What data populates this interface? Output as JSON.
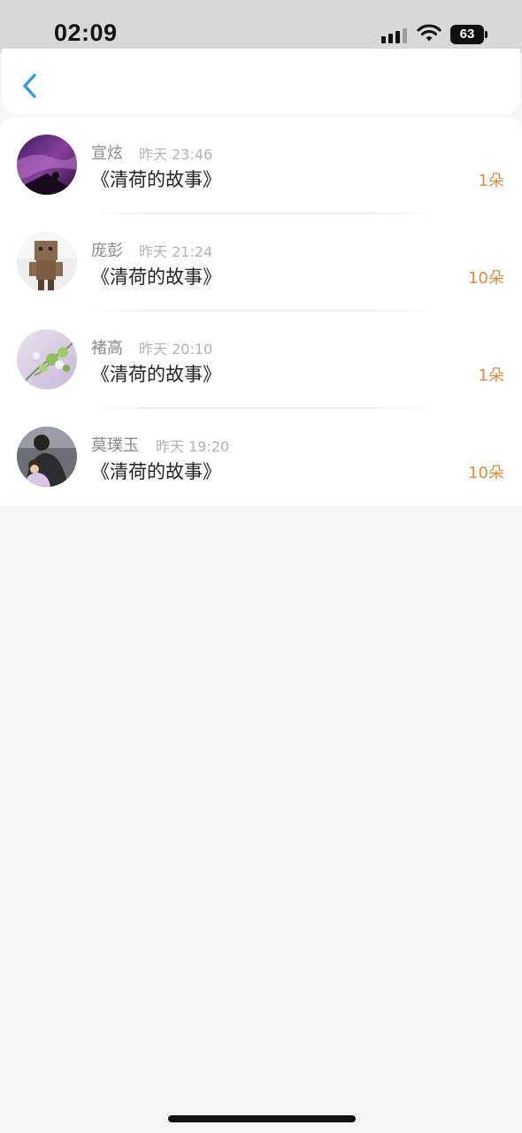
{
  "status_bar": {
    "time": "02:09",
    "battery": "63",
    "icons": [
      "signal-icon",
      "wifi-icon",
      "battery-icon"
    ]
  },
  "header": {
    "back_icon": "chevron-left-icon",
    "accent_color": "#2e9fdc"
  },
  "records": [
    {
      "name": "宣炫",
      "time": "昨天 23:46",
      "title": "《清荷的故事》",
      "count": "1朵"
    },
    {
      "name": "庞彭",
      "time": "昨天 21:24",
      "title": "《清荷的故事》",
      "count": "10朵"
    },
    {
      "name": "褚高",
      "time": "昨天 20:10",
      "title": "《清荷的故事》",
      "count": "1朵"
    },
    {
      "name": "莫璞玉",
      "time": "昨天 19:20",
      "title": "《清荷的故事》",
      "count": "10朵"
    }
  ],
  "colors": {
    "count": "#e08a3c",
    "name": "#8a8a8a",
    "time": "#b3b3b3"
  }
}
